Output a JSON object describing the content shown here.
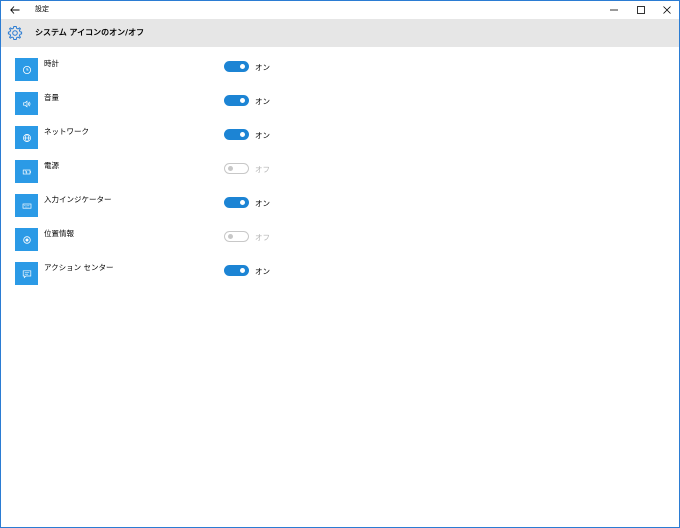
{
  "window": {
    "title": "設定",
    "page_title": "システム アイコンのオン/オフ"
  },
  "colors": {
    "accent": "#2b9ae6",
    "toggle_on": "#1c84d4",
    "header_bg": "#e6e6e6"
  },
  "items": [
    {
      "label": "時計",
      "icon": "clock-icon",
      "on": true,
      "state": "オン"
    },
    {
      "label": "音量",
      "icon": "volume-icon",
      "on": true,
      "state": "オン"
    },
    {
      "label": "ネットワーク",
      "icon": "network-icon",
      "on": true,
      "state": "オン"
    },
    {
      "label": "電源",
      "icon": "battery-icon",
      "on": false,
      "state": "オフ"
    },
    {
      "label": "入力インジケーター",
      "icon": "keyboard-icon",
      "on": true,
      "state": "オン"
    },
    {
      "label": "位置情報",
      "icon": "location-icon",
      "on": false,
      "state": "オフ"
    },
    {
      "label": "アクション センター",
      "icon": "action-center-icon",
      "on": true,
      "state": "オン"
    }
  ]
}
